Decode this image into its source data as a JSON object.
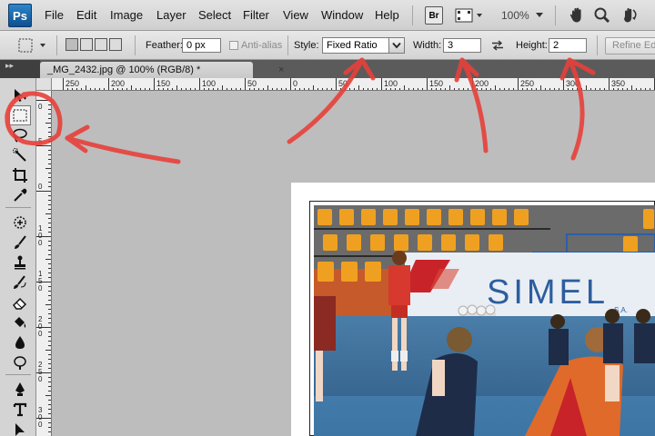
{
  "app": {
    "logo_text": "Ps"
  },
  "menu": [
    "File",
    "Edit",
    "Image",
    "Layer",
    "Select",
    "Filter",
    "View",
    "Window",
    "Help"
  ],
  "menubar_right": {
    "bridge_label": "Br",
    "zoom": "100%"
  },
  "options": {
    "feather_label": "Feather:",
    "feather_value": "0 px",
    "antialias_label": "Anti-alias",
    "style_label": "Style:",
    "style_value": "Fixed Ratio",
    "width_label": "Width:",
    "width_value": "3",
    "height_label": "Height:",
    "height_value": "2",
    "refine_label": "Refine Edge..."
  },
  "document": {
    "tab_title": "_MG_2432.jpg @ 100% (RGB/8) *",
    "close_glyph": "×"
  },
  "ruler_top": [
    "250",
    "200",
    "150",
    "100",
    "50",
    "0",
    "50",
    "100",
    "150",
    "200",
    "250",
    "300",
    "350"
  ],
  "ruler_left": [
    "0",
    "5",
    "0",
    "1 0 0",
    "1 5 0",
    "2 0 0",
    "2 5 0",
    "3 0 0"
  ],
  "tools": [
    "move-tool",
    "rectangular-marquee-tool",
    "lasso-tool",
    "quick-selection-tool",
    "crop-tool",
    "eyedropper-tool",
    "healing-brush-tool",
    "brush-tool",
    "clone-stamp-tool",
    "history-brush-tool",
    "eraser-tool",
    "paint-bucket-tool",
    "blur-tool",
    "dodge-tool",
    "pen-tool",
    "type-tool",
    "path-selection-tool"
  ],
  "photo": {
    "banner_text": "SIMEL",
    "banner_small": "S.A."
  },
  "colors": {
    "annotation": "#e8403a",
    "photoshop_blue": "#1c6fb5",
    "panel_gray": "#d4d4d4",
    "canvas_gray": "#bdbdbd"
  }
}
